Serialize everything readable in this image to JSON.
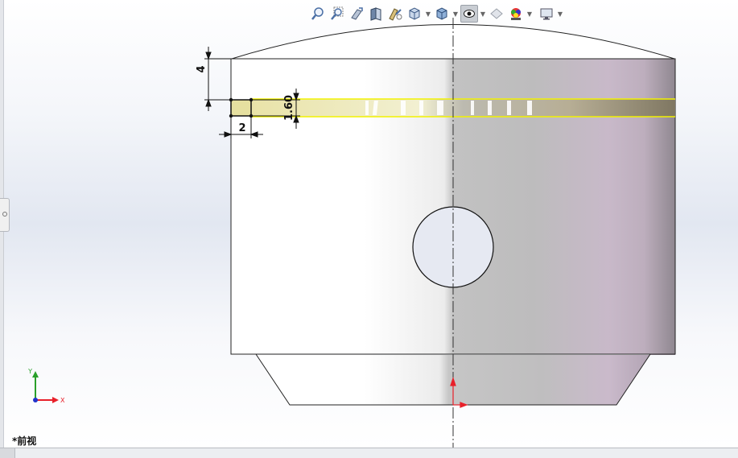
{
  "view": {
    "name": "*前视"
  },
  "dimensions": {
    "groove_depth": "4",
    "groove_width": "2",
    "groove_height": "1.60"
  },
  "triad": {
    "y_label": "Y",
    "x_label": "X"
  },
  "toolbar": {
    "items": [
      "zoom-to-fit-icon",
      "zoom-to-area-icon",
      "previous-view-icon",
      "section-view-icon",
      "dynamic-annotation-icon",
      "view-orientation-icon",
      "display-style-icon",
      "hide-show-items-icon",
      "edit-appearance-icon",
      "apply-scene-icon",
      "view-settings-icon"
    ],
    "active_item": "display-style-icon"
  },
  "colors": {
    "ring_highlight": "#f2f200",
    "axis_x": "#e8202a",
    "axis_y": "#2aa02a",
    "axis_z": "#2233cc"
  }
}
